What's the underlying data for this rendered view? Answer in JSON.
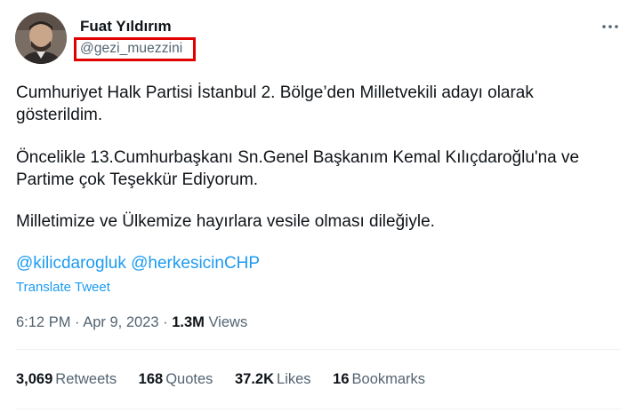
{
  "author": {
    "display_name": "Fuat Yıldırım",
    "handle": "@gezi_muezzini"
  },
  "menu": {
    "more_icon": "more-horizontal-icon",
    "more_label": "···"
  },
  "tweet": {
    "paragraphs": [
      "Cumhuriyet Halk Partisi İstanbul 2. Bölge’den Milletvekili adayı olarak gösterildim.",
      "Öncelikle 13.Cumhurbaşkanı Sn.Genel Başkanım Kemal Kılıçdaroğlu'na ve Partime çok Teşekkür Ediyorum.",
      "Milletimize ve  Ülkemize hayırlara vesile olması dileğiyle."
    ],
    "mentions": [
      "@kilicdarogluk",
      "@herkesicinCHP"
    ],
    "translate_label": "Translate Tweet"
  },
  "meta": {
    "time": "6:12 PM",
    "separator1": " · ",
    "date": "Apr 9, 2023",
    "separator2": " · ",
    "views_count": "1.3M",
    "views_label": " Views"
  },
  "stats": {
    "retweets_count": "3,069",
    "retweets_label": "Retweets",
    "quotes_count": "168",
    "quotes_label": "Quotes",
    "likes_count": "37.2K",
    "likes_label": "Likes",
    "bookmarks_count": "16",
    "bookmarks_label": "Bookmarks"
  },
  "colors": {
    "link": "#1d9bf0",
    "secondary": "#536471",
    "highlight_box": "#e00000"
  }
}
